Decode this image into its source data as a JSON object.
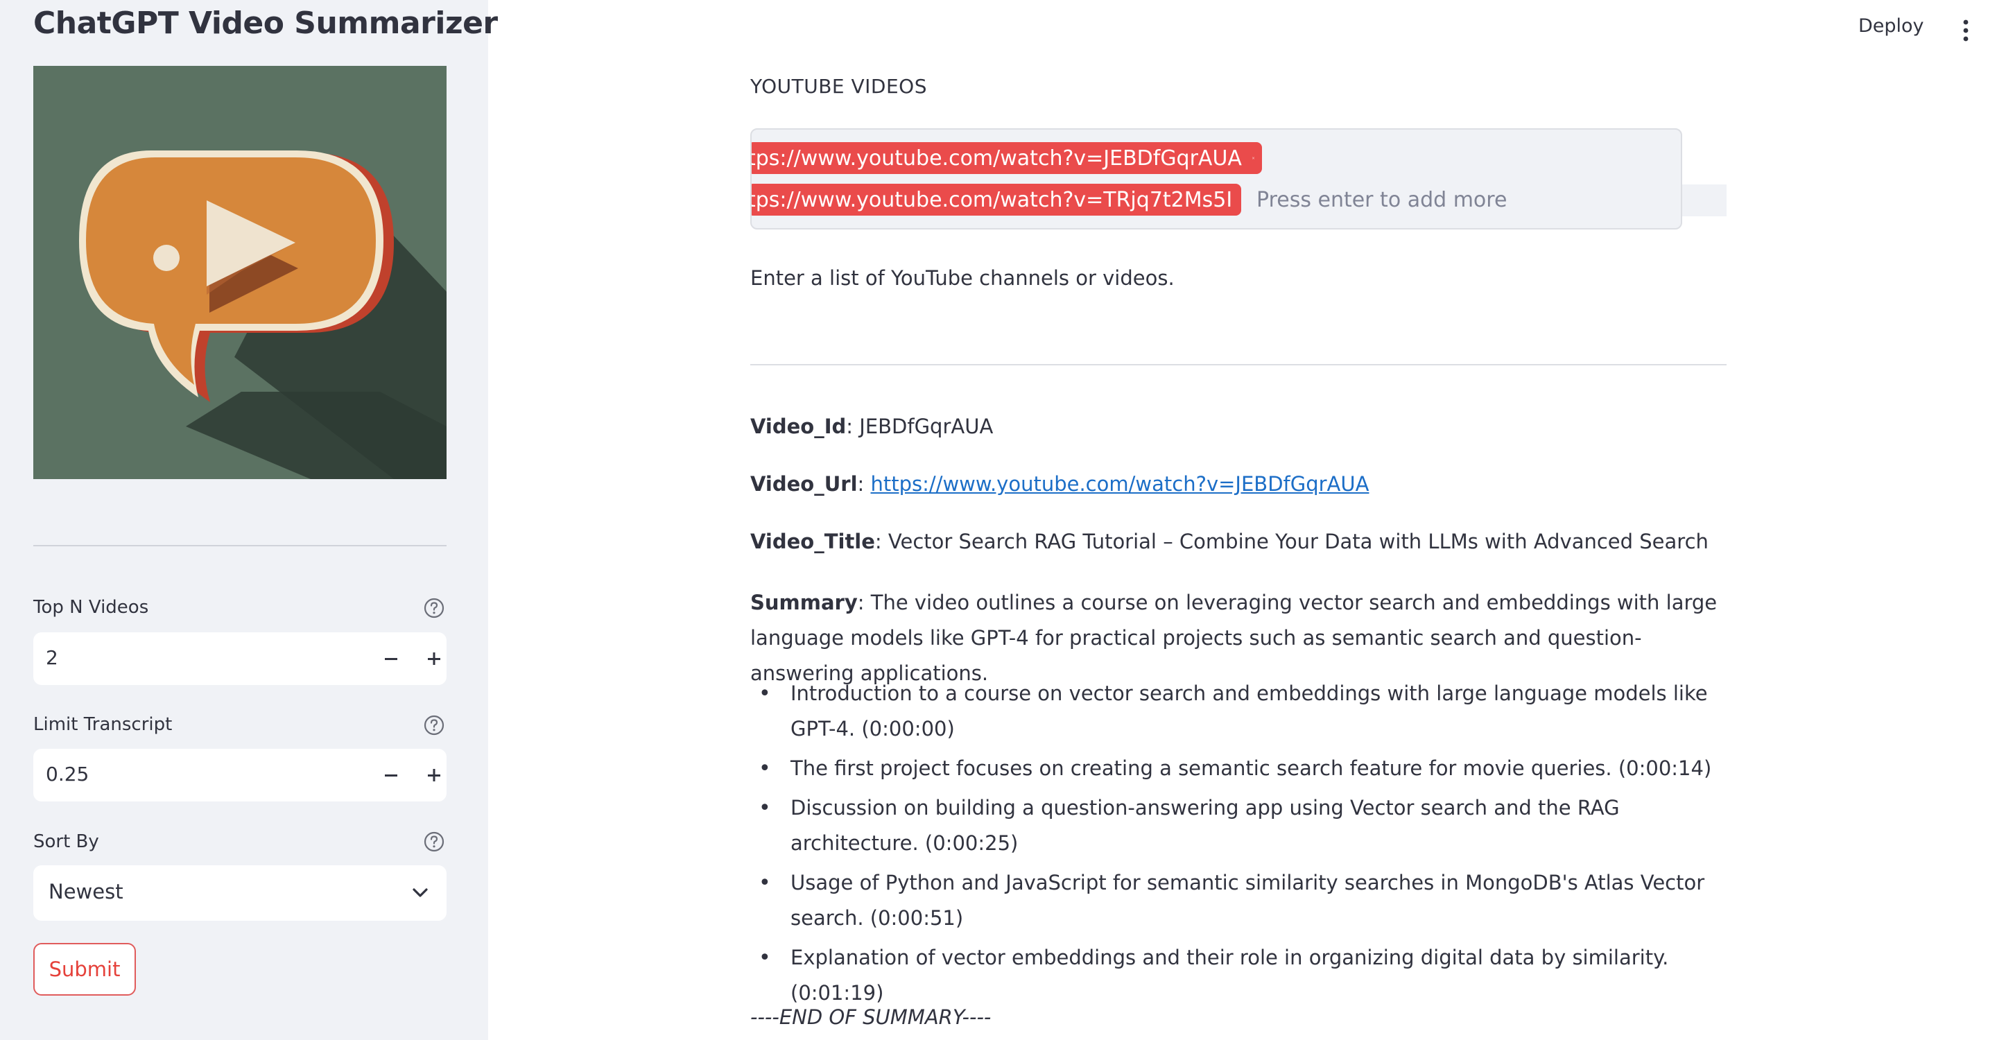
{
  "sidebar": {
    "title": "ChatGPT Video Summarizer",
    "top_n": {
      "label": "Top N Videos",
      "value": "2"
    },
    "limit_transcript": {
      "label": "Limit Transcript",
      "value": "0.25"
    },
    "sort_by": {
      "label": "Sort By",
      "value": "Newest"
    },
    "submit_label": "Submit"
  },
  "header": {
    "deploy_label": "Deploy"
  },
  "main": {
    "input_label": "YOUTUBE VIDEOS",
    "tags": [
      "tps://www.youtube.com/watch?v=JEBDfGqrAUA",
      "tps://www.youtube.com/watch?v=TRjq7t2Ms5I"
    ],
    "tag_placeholder": "Press enter to add more",
    "caption": "Enter a list of YouTube channels or videos.",
    "video": {
      "id_key": "Video_Id",
      "id_value": ": JEBDfGqrAUA",
      "url_key": "Video_Url",
      "url_sep": ": ",
      "url_value": "https://www.youtube.com/watch?v=JEBDfGqrAUA",
      "title_key": "Video_Title",
      "title_value": ": Vector Search RAG Tutorial – Combine Your Data with LLMs with Advanced Search",
      "summary_key": "Summary",
      "summary_value": ": The video outlines a course on leveraging vector search and embeddings with large language models like GPT-4 for practical projects such as semantic search and question-answering applications."
    },
    "bullets": [
      "Introduction to a course on vector search and embeddings with large language models like GPT-4. (0:00:00)",
      "The first project focuses on creating a semantic search feature for movie queries. (0:00:14)",
      "Discussion on building a question-answering app using Vector search and the RAG architecture. (0:00:25)",
      "Usage of Python and JavaScript for semantic similarity searches in MongoDB's Atlas Vector search. (0:00:51)",
      "Explanation of vector embeddings and their role in organizing digital data by similarity. (0:01:19)"
    ],
    "end_text": "----END OF SUMMARY----"
  },
  "colors": {
    "accent": "#ea4b4b",
    "link": "#1c6ec7",
    "sidebar_bg": "#f0f2f6",
    "logo_bg": "#5b7262",
    "logo_bubble": "#d6873b"
  },
  "icons": {
    "logo": "video-chat-bubble-logo",
    "help": "question-circle-icon",
    "tag_remove": "close-icon",
    "dropdown": "chevron-down-icon",
    "menu": "kebab-menu-icon"
  }
}
